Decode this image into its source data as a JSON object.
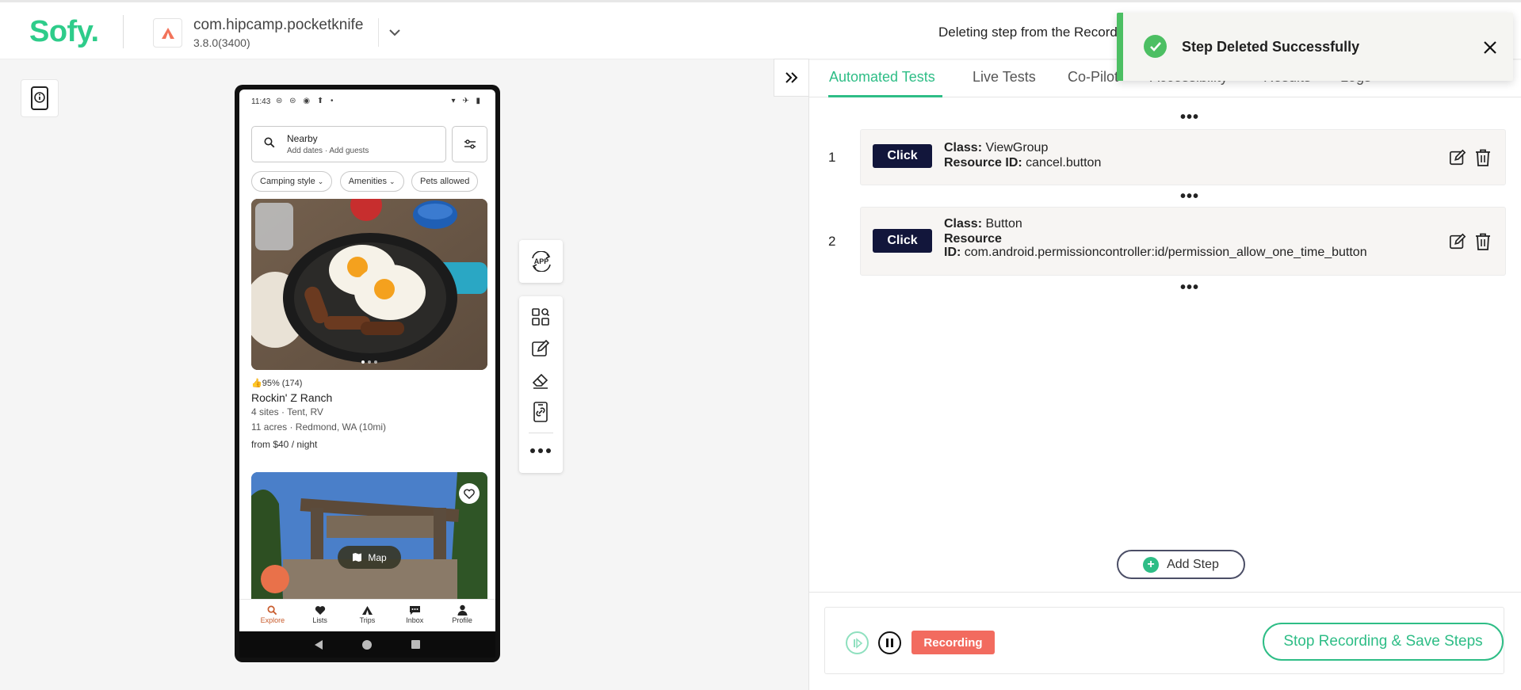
{
  "colors": {
    "brand": "#2ecc8a",
    "accent_green": "#2ebd86",
    "click_badge": "#12163b",
    "recording": "#f26b5f",
    "toast_success": "#4cbf63"
  },
  "header": {
    "logo": "Sofy.",
    "app_name": "com.hipcamp.pocketknife",
    "app_version": "3.8.0(3400)",
    "status_message": "Deleting step from the Recording"
  },
  "toast": {
    "message": "Step Deleted Successfully",
    "icon": "check-circle-icon",
    "close_icon": "close-icon"
  },
  "device": {
    "status_time": "11:43",
    "search_title": "Nearby",
    "search_subtitle": "Add dates · Add guests",
    "chips": [
      "Camping style",
      "Amenities",
      "Pets allowed"
    ],
    "listing": {
      "rating": "95% (174)",
      "name": "Rockin' Z Ranch",
      "sites": "4 sites · Tent, RV",
      "location": "11 acres · Redmond, WA (10mi)",
      "price": "from $40 / night"
    },
    "map_button": "Map",
    "bottom_tabs": [
      "Explore",
      "Lists",
      "Trips",
      "Inbox",
      "Profile"
    ],
    "active_tab": "Explore"
  },
  "tools": {
    "app_label": "APP",
    "items": [
      "element-inspector-icon",
      "edit-icon",
      "eraser-icon",
      "device-link-icon",
      "more-icon"
    ]
  },
  "tabs": [
    {
      "label": "Automated Tests",
      "active": true
    },
    {
      "label": "Live Tests",
      "active": false
    },
    {
      "label": "Co-Pilot",
      "active": false
    },
    {
      "label": "Accessibility",
      "active": false
    },
    {
      "label": "Results",
      "active": false
    },
    {
      "label": "Logs",
      "active": false
    }
  ],
  "steps": [
    {
      "number": "1",
      "action": "Click",
      "class_label": "Class:",
      "class_value": "ViewGroup",
      "resource_label": "Resource ID:",
      "resource_value": "cancel.button"
    },
    {
      "number": "2",
      "action": "Click",
      "class_label": "Class:",
      "class_value": "Button",
      "resource_label_line1": "Resource",
      "resource_label_line2": "ID:",
      "resource_value": "com.android.permissioncontroller:id/permission_allow_one_time_button"
    }
  ],
  "ellipsis": "•••",
  "add_step": "Add Step",
  "recording": {
    "badge": "Recording",
    "stop_button": "Stop Recording & Save Steps"
  }
}
